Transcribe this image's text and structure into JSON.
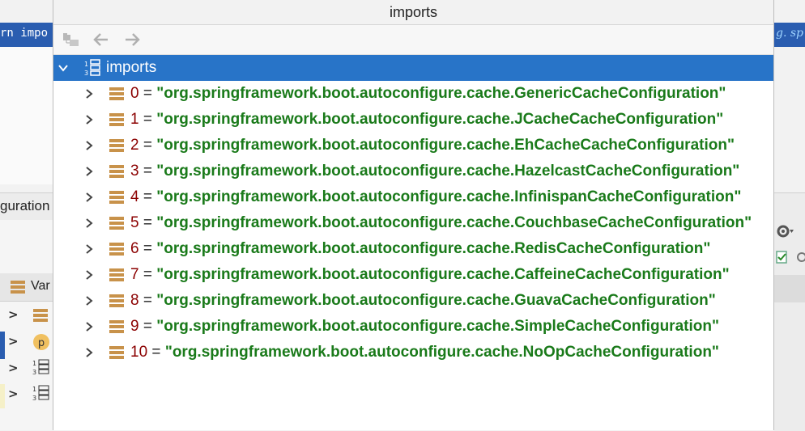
{
  "background": {
    "code_left": "rn impo",
    "code_right": "g. sp",
    "tab_label": "guration",
    "variables_label": "Var"
  },
  "popup": {
    "title": "imports",
    "toolbar": {
      "items": [
        "tree-view-icon",
        "back-arrow-icon",
        "forward-arrow-icon"
      ]
    },
    "root": {
      "label": "imports",
      "icon": "array-icon",
      "expanded": true
    },
    "items": [
      {
        "index": "0",
        "value": "\"org.springframework.boot.autoconfigure.cache.GenericCacheConfiguration\""
      },
      {
        "index": "1",
        "value": "\"org.springframework.boot.autoconfigure.cache.JCacheCacheConfiguration\""
      },
      {
        "index": "2",
        "value": "\"org.springframework.boot.autoconfigure.cache.EhCacheCacheConfiguration\""
      },
      {
        "index": "3",
        "value": "\"org.springframework.boot.autoconfigure.cache.HazelcastCacheConfiguration\""
      },
      {
        "index": "4",
        "value": "\"org.springframework.boot.autoconfigure.cache.InfinispanCacheConfiguration\""
      },
      {
        "index": "5",
        "value": "\"org.springframework.boot.autoconfigure.cache.CouchbaseCacheConfiguration\""
      },
      {
        "index": "6",
        "value": "\"org.springframework.boot.autoconfigure.cache.RedisCacheConfiguration\""
      },
      {
        "index": "7",
        "value": "\"org.springframework.boot.autoconfigure.cache.CaffeineCacheConfiguration\""
      },
      {
        "index": "8",
        "value": "\"org.springframework.boot.autoconfigure.cache.GuavaCacheConfiguration\""
      },
      {
        "index": "9",
        "value": "\"org.springframework.boot.autoconfigure.cache.SimpleCacheConfiguration\""
      },
      {
        "index": "10",
        "value": "\"org.springframework.boot.autoconfigure.cache.NoOpCacheConfiguration\""
      }
    ],
    "equals": "=",
    "colors": {
      "selection": "#2874c8",
      "index": "#8b0000",
      "string": "#1a7a1a",
      "field_icon": "#c8924a"
    }
  }
}
